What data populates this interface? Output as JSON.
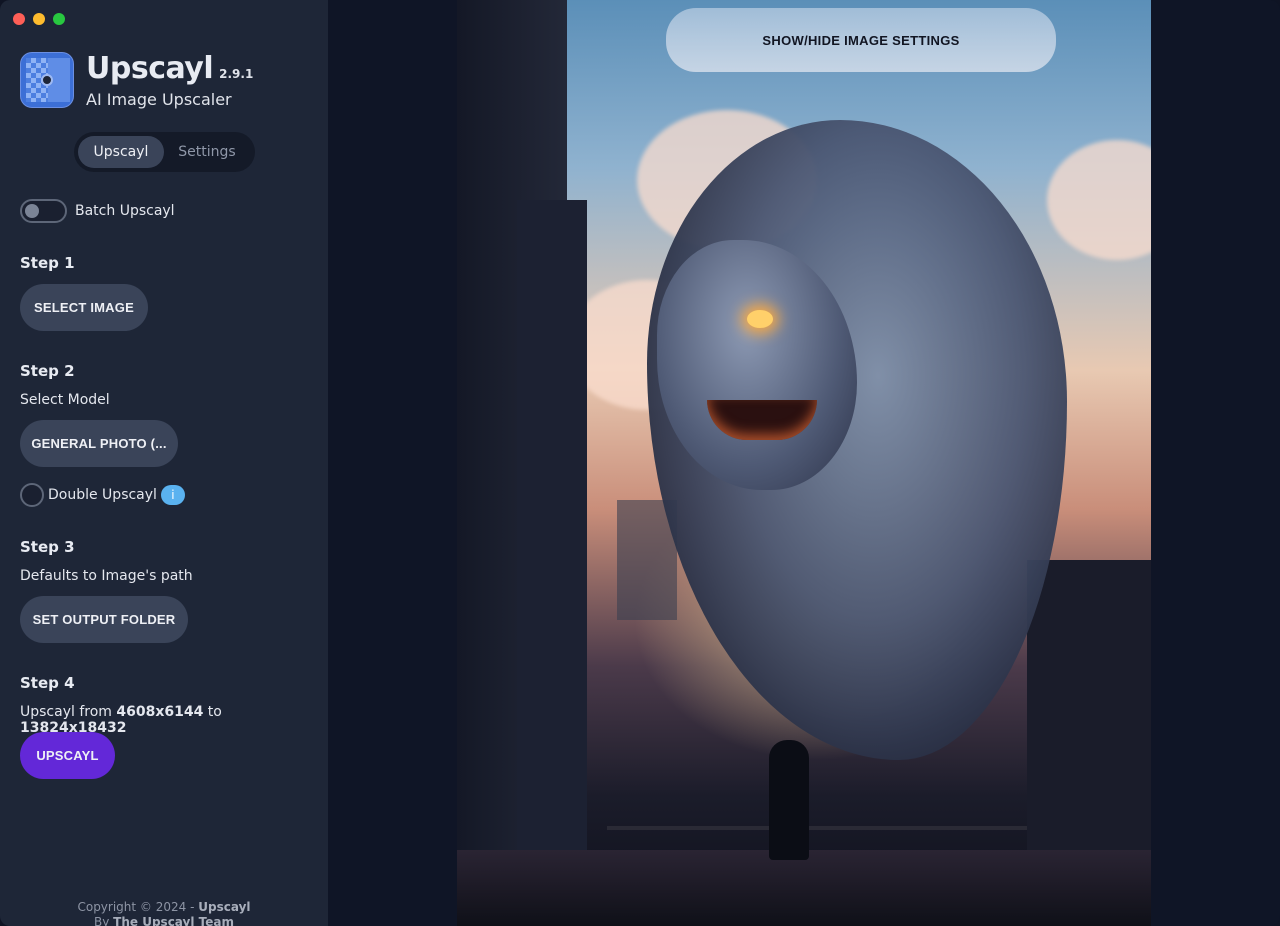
{
  "app": {
    "name": "Upscayl",
    "version": "2.9.1",
    "tagline": "AI Image Upscaler"
  },
  "tabs": [
    {
      "label": "Upscayl",
      "active": true
    },
    {
      "label": "Settings",
      "active": false
    }
  ],
  "batch": {
    "label": "Batch Upscayl",
    "enabled": false
  },
  "step1": {
    "title": "Step 1",
    "button": "SELECT IMAGE"
  },
  "step2": {
    "title": "Step 2",
    "subtitle": "Select Model",
    "model_button": "GENERAL PHOTO (...",
    "double_label": "Double Upscayl",
    "double_checked": false,
    "info_icon": "i"
  },
  "step3": {
    "title": "Step 3",
    "subtitle": "Defaults to Image's path",
    "button": "SET OUTPUT FOLDER"
  },
  "step4": {
    "title": "Step 4",
    "prefix": "Upscayl from",
    "from": "4608x6144",
    "to_word": "to",
    "to": "13824x18432",
    "button": "UPSCAYL"
  },
  "footer": {
    "copyright_prefix": "Copyright © 2024 -",
    "copyright_name": "Upscayl",
    "by_prefix": "By",
    "by_name": "The Upscayl Team"
  },
  "main": {
    "settings_toggle": "SHOW/HIDE IMAGE SETTINGS",
    "image_description_icon": "dragon-image"
  },
  "colors": {
    "sidebar_bg": "#1e2637",
    "main_bg": "#0f1526",
    "button_bg": "#3a4459",
    "primary": "#6328d8",
    "info": "#5ab2f0"
  }
}
